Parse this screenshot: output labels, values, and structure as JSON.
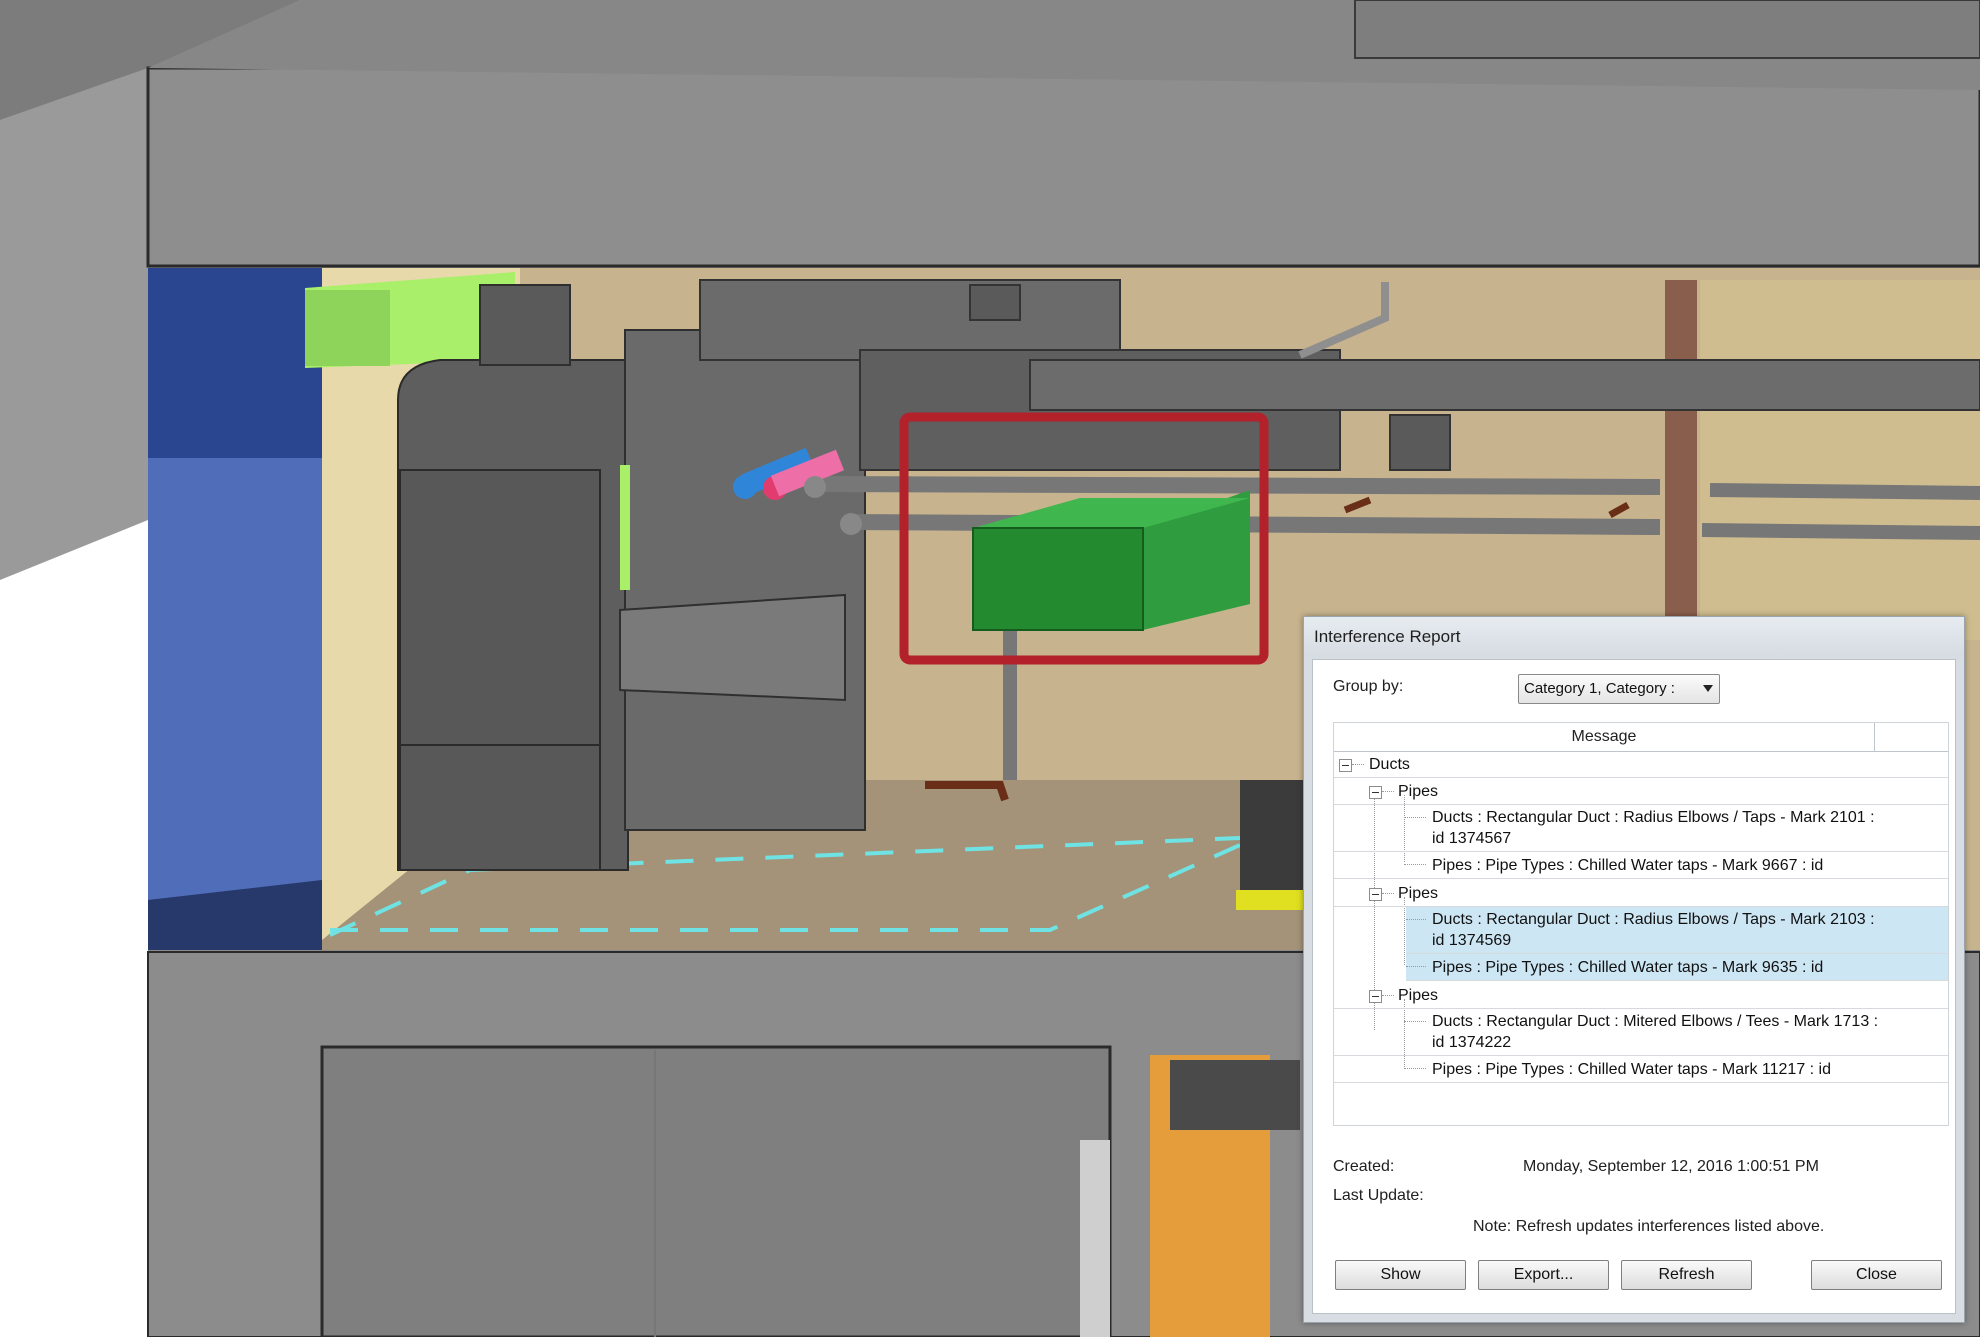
{
  "dialog": {
    "title": "Interference Report",
    "group_by_label": "Group by:",
    "group_by_value": "Category 1, Category :",
    "column_message": "Message",
    "tree": [
      {
        "level": 0,
        "label": "Ducts"
      },
      {
        "level": 1,
        "label": "Pipes"
      },
      {
        "level": 2,
        "label": "Ducts : Rectangular Duct : Radius Elbows / Taps - Mark 2101 :",
        "label2": "id 1374567",
        "selected": false
      },
      {
        "level": 2,
        "label": "Pipes : Pipe Types : Chilled Water taps - Mark 9667 : id",
        "selected": false
      },
      {
        "level": 1,
        "label": "Pipes"
      },
      {
        "level": 2,
        "label": "Ducts : Rectangular Duct : Radius Elbows / Taps - Mark 2103 :",
        "label2": "id 1374569",
        "selected": true
      },
      {
        "level": 2,
        "label": "Pipes : Pipe Types : Chilled Water taps - Mark 9635 : id",
        "selected": true
      },
      {
        "level": 1,
        "label": "Pipes"
      },
      {
        "level": 2,
        "label": "Ducts : Rectangular Duct : Mitered Elbows / Tees - Mark 1713 :",
        "label2": "id 1374222",
        "selected": false
      },
      {
        "level": 2,
        "label": "Pipes : Pipe Types : Chilled Water taps - Mark 11217 : id",
        "selected": false
      }
    ],
    "created_label": "Created:",
    "created_value": "Monday, September 12, 2016 1:00:51 PM",
    "last_update_label": "Last Update:",
    "last_update_value": "",
    "note": "Note: Refresh updates interferences listed above.",
    "buttons": {
      "show": "Show",
      "export": "Export...",
      "refresh": "Refresh",
      "close": "Close"
    }
  },
  "colors": {
    "highlight_box": "#b3212a",
    "clash_duct": "#2f9d3f",
    "selection": "#cde6f4",
    "clearance_line": "#6fe3e3"
  }
}
